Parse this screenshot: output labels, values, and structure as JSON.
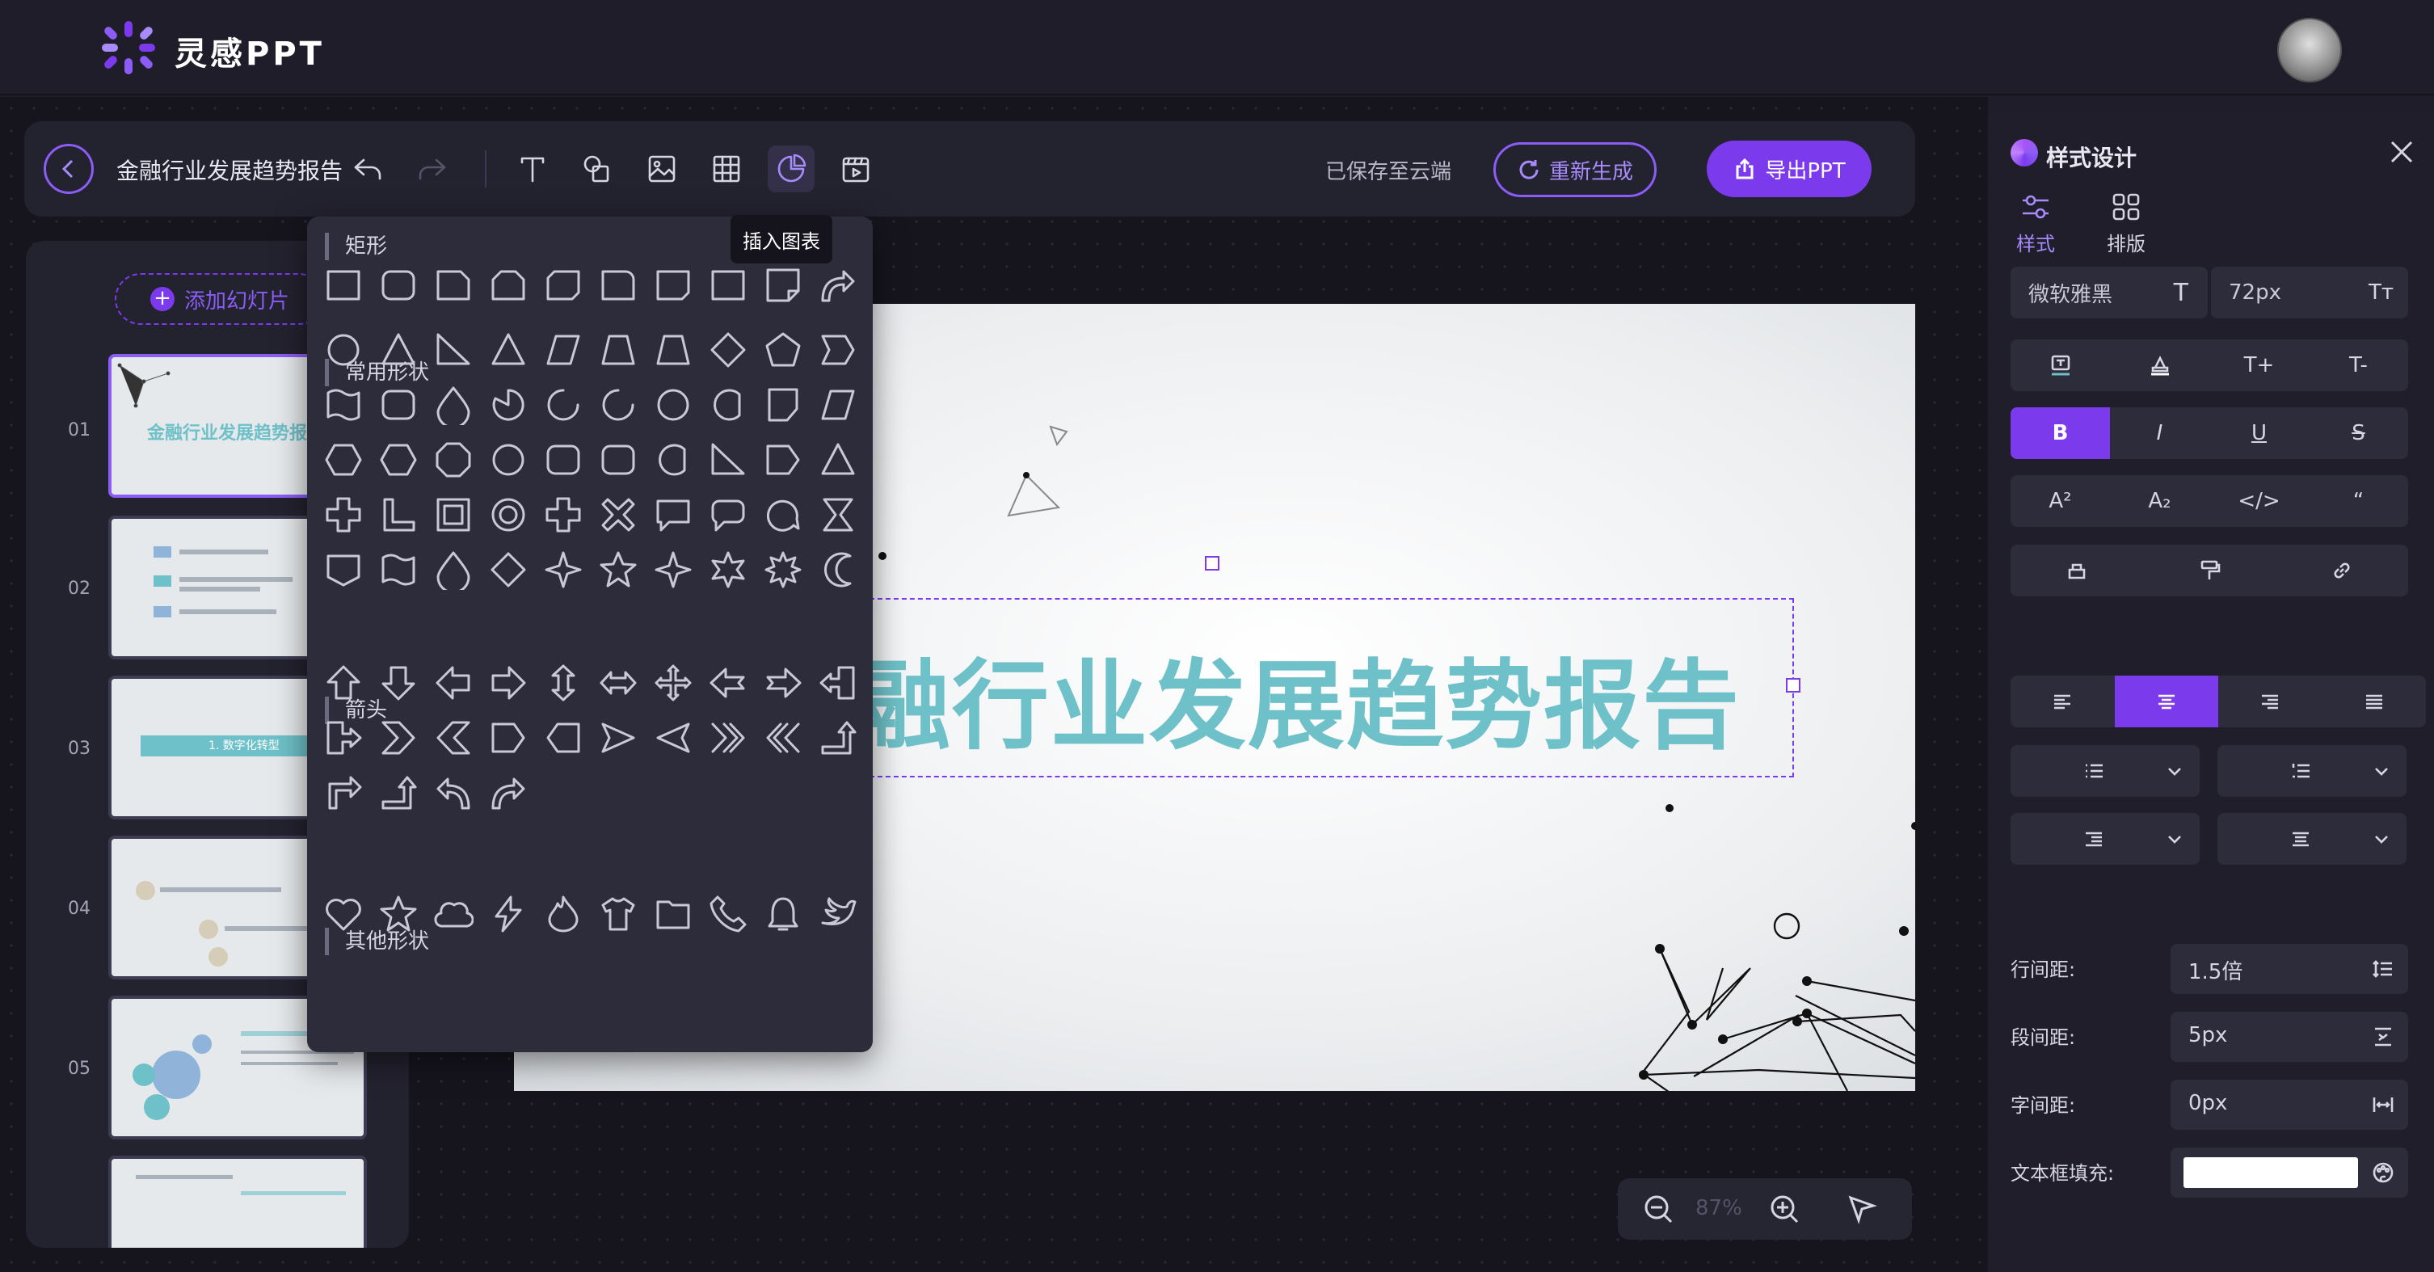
{
  "app": {
    "name": "灵感PPT"
  },
  "toolbar": {
    "doc_title": "金融行业发展趋势报告",
    "saved_status": "已保存至云端",
    "regenerate_label": "重新生成",
    "export_label": "导出PPT",
    "tooltip": "插入图表"
  },
  "slides_panel": {
    "add_slide_label": "添加幻灯片",
    "slides": [
      {
        "num": "01",
        "title": "金融行业发展趋势报告"
      },
      {
        "num": "02",
        "title": ""
      },
      {
        "num": "03",
        "title": "1. 数字化转型"
      },
      {
        "num": "04",
        "title": ""
      },
      {
        "num": "05",
        "title": ""
      }
    ]
  },
  "canvas": {
    "main_title": "融行业发展趋势报告",
    "zoom": "87%"
  },
  "shape_panel": {
    "sections": {
      "rect": "矩形",
      "common": "常用形状",
      "arrows": "箭头",
      "other": "其他形状"
    }
  },
  "right_panel": {
    "title": "样式设计",
    "tab_style": "样式",
    "tab_layout": "排版",
    "font_name": "微软雅黑",
    "font_size": "72px",
    "font_glyph": "T",
    "font_size_glyph": "Tт",
    "bold": "B",
    "italic": "I",
    "underline": "U",
    "strike": "S",
    "superscript": "A²",
    "subscript": "A₂",
    "code": "</>",
    "quote": "“",
    "grow": "T+",
    "shrink": "T-",
    "line_spacing_label": "行间距:",
    "line_spacing_value": "1.5倍",
    "para_spacing_label": "段间距:",
    "para_spacing_value": "5px",
    "char_spacing_label": "字间距:",
    "char_spacing_value": "0px",
    "fill_label": "文本框填充:",
    "fill_color": "#ffffff"
  },
  "colors": {
    "accent": "#7c3aed",
    "accent_light": "#a78bfa",
    "title_teal": "#6ec1c8",
    "panel": "#23222f"
  }
}
